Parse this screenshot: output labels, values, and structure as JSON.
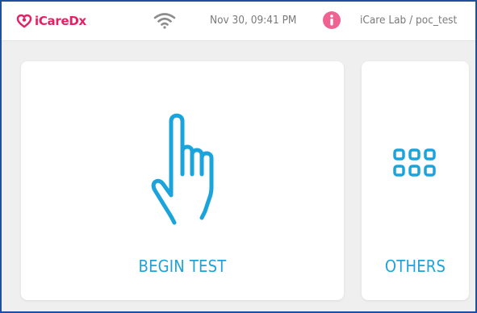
{
  "header": {
    "logo_text": "iCareDx",
    "datetime": "Nov 30, 09:41 PM",
    "location": "iCare Lab / poc_test",
    "icons": [
      "heart-logo-icon",
      "wifi-icon",
      "info-icon"
    ]
  },
  "main": {
    "cards": [
      {
        "label": "BEGIN TEST",
        "icon": "hand-pointer-icon"
      },
      {
        "label": "OTHERS",
        "icon": "grid-icon"
      }
    ]
  },
  "colors": {
    "brand": "#e91e63",
    "accent": "#1ba4dc",
    "info_icon": "#f06292",
    "frame_border": "#1f4fa0",
    "muted_text": "#7a7a7a",
    "background": "#efefef"
  }
}
